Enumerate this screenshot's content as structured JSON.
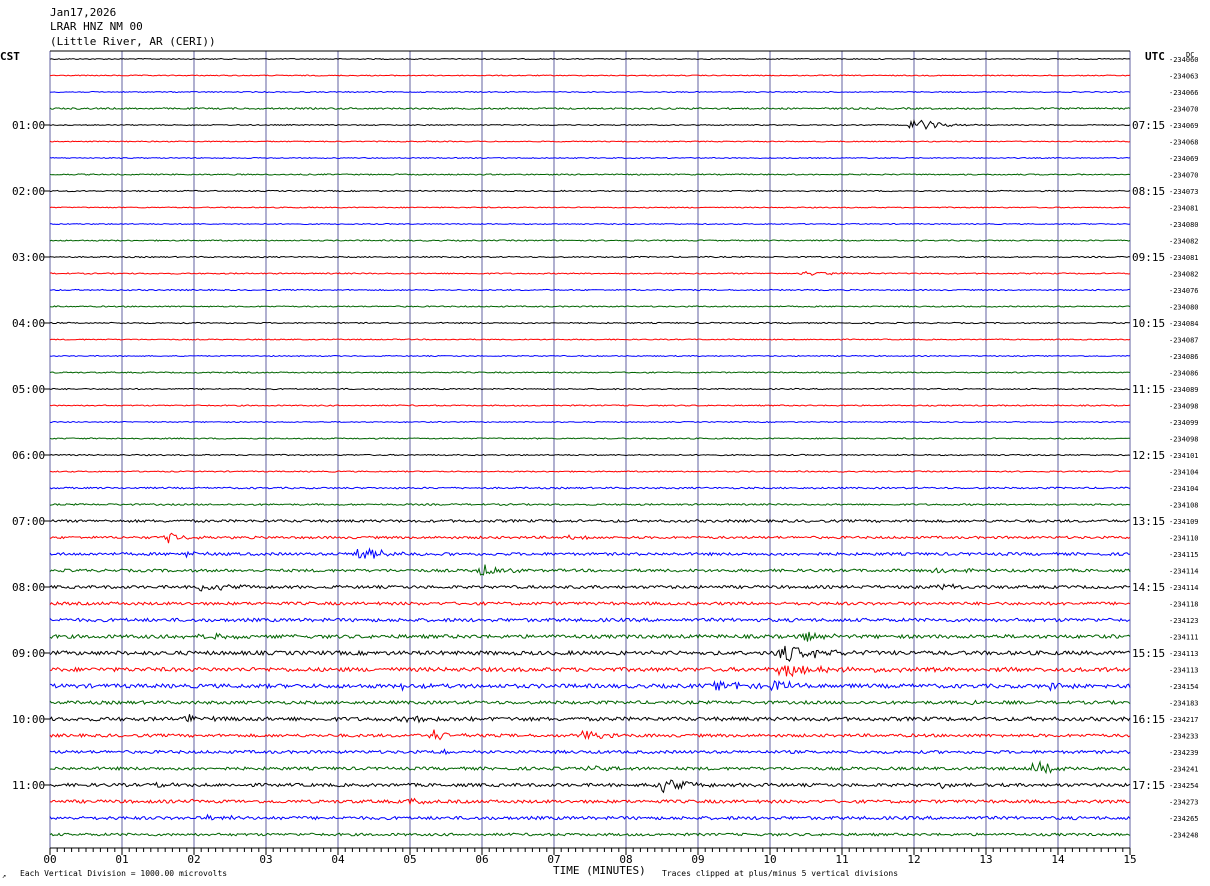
{
  "header": {
    "date": "Jan17,2026",
    "station": "LRAR HNZ NM 00",
    "location": "(Little River, AR (CERI))"
  },
  "left_zone_label": "CST",
  "right_zone_label": "UTC",
  "dc_label": "DC",
  "footer": {
    "scale_note": "Each Vertical Division = 1000.00 microvolts",
    "axis_title": "TIME (MINUTES)",
    "clip_note": "Traces clipped at plus/minus 5 vertical divisions"
  },
  "colors": {
    "black": "#000000",
    "red": "#ff0000",
    "blue": "#0000ff",
    "green": "#006400",
    "grid": "#6060a0"
  },
  "chart_data": {
    "type": "line",
    "x_ticks": [
      "00",
      "01",
      "02",
      "03",
      "04",
      "05",
      "06",
      "07",
      "08",
      "09",
      "10",
      "11",
      "12",
      "13",
      "14",
      "15"
    ],
    "xlim": [
      0,
      15
    ],
    "left_hour_labels": [
      "01:00",
      "02:00",
      "03:00",
      "04:00",
      "05:00",
      "06:00",
      "07:00",
      "08:00",
      "09:00",
      "10:00",
      "11:00"
    ],
    "right_hour_labels": [
      "07:15",
      "08:15",
      "09:15",
      "10:15",
      "11:15",
      "12:15",
      "13:15",
      "14:15",
      "15:15",
      "16:15",
      "17:15"
    ],
    "color_cycle": [
      "black",
      "red",
      "blue",
      "green"
    ],
    "traces": [
      {
        "dc": "-234060",
        "noise": 0.5,
        "events": []
      },
      {
        "dc": "-234063",
        "noise": 0.5,
        "events": []
      },
      {
        "dc": "-234066",
        "noise": 0.5,
        "events": []
      },
      {
        "dc": "-234070",
        "noise": 0.8,
        "events": []
      },
      {
        "dc": "-234069",
        "noise": 0.5,
        "events": [
          {
            "t": 12.0,
            "amp": 9,
            "dur": 0.35
          }
        ]
      },
      {
        "dc": "-234068",
        "noise": 0.5,
        "events": []
      },
      {
        "dc": "-234069",
        "noise": 0.5,
        "events": []
      },
      {
        "dc": "-234070",
        "noise": 0.6,
        "events": []
      },
      {
        "dc": "-234073",
        "noise": 0.6,
        "events": []
      },
      {
        "dc": "-234081",
        "noise": 0.5,
        "events": []
      },
      {
        "dc": "-234080",
        "noise": 0.5,
        "events": []
      },
      {
        "dc": "-234082",
        "noise": 0.6,
        "events": []
      },
      {
        "dc": "-234081",
        "noise": 0.6,
        "events": []
      },
      {
        "dc": "-234082",
        "noise": 0.6,
        "events": [
          {
            "t": 10.5,
            "amp": 2,
            "dur": 0.6
          }
        ]
      },
      {
        "dc": "-234076",
        "noise": 0.6,
        "events": []
      },
      {
        "dc": "-234080",
        "noise": 0.6,
        "events": []
      },
      {
        "dc": "-234084",
        "noise": 0.6,
        "events": []
      },
      {
        "dc": "-234087",
        "noise": 0.5,
        "events": []
      },
      {
        "dc": "-234086",
        "noise": 0.5,
        "events": []
      },
      {
        "dc": "-234086",
        "noise": 0.6,
        "events": []
      },
      {
        "dc": "-234089",
        "noise": 0.6,
        "events": []
      },
      {
        "dc": "-234098",
        "noise": 0.6,
        "events": []
      },
      {
        "dc": "-234099",
        "noise": 0.5,
        "events": []
      },
      {
        "dc": "-234098",
        "noise": 0.6,
        "events": []
      },
      {
        "dc": "-234101",
        "noise": 0.6,
        "events": []
      },
      {
        "dc": "-234104",
        "noise": 0.6,
        "events": []
      },
      {
        "dc": "-234104",
        "noise": 0.8,
        "events": []
      },
      {
        "dc": "-234108",
        "noise": 0.8,
        "events": []
      },
      {
        "dc": "-234109",
        "noise": 1.3,
        "events": []
      },
      {
        "dc": "-234110",
        "noise": 1.2,
        "events": [
          {
            "t": 1.65,
            "amp": 5,
            "dur": 0.3
          },
          {
            "t": 7.2,
            "amp": 2,
            "dur": 0.3
          }
        ]
      },
      {
        "dc": "-234115",
        "noise": 1.4,
        "events": [
          {
            "t": 4.3,
            "amp": 8,
            "dur": 0.4
          },
          {
            "t": 1.9,
            "amp": 3,
            "dur": 0.3
          }
        ]
      },
      {
        "dc": "-234114",
        "noise": 1.4,
        "events": [
          {
            "t": 6.0,
            "amp": 7,
            "dur": 0.35
          },
          {
            "t": 12.3,
            "amp": 3,
            "dur": 0.4
          }
        ]
      },
      {
        "dc": "-234114",
        "noise": 1.5,
        "events": [
          {
            "t": 2.1,
            "amp": 5,
            "dur": 0.5
          },
          {
            "t": 6.9,
            "amp": 3,
            "dur": 0.2
          },
          {
            "t": 12.4,
            "amp": 4,
            "dur": 0.3
          }
        ]
      },
      {
        "dc": "-234118",
        "noise": 1.5,
        "events": []
      },
      {
        "dc": "-234123",
        "noise": 1.7,
        "events": []
      },
      {
        "dc": "-234111",
        "noise": 1.8,
        "events": [
          {
            "t": 1.7,
            "amp": 3,
            "dur": 0.3
          },
          {
            "t": 2.2,
            "amp": 3,
            "dur": 0.4
          },
          {
            "t": 10.5,
            "amp": 5,
            "dur": 0.3
          }
        ]
      },
      {
        "dc": "-234113",
        "noise": 2.0,
        "events": [
          {
            "t": 10.2,
            "amp": 9,
            "dur": 0.6
          },
          {
            "t": 7.8,
            "amp": 2,
            "dur": 0.8
          }
        ]
      },
      {
        "dc": "-234113",
        "noise": 2.0,
        "events": [
          {
            "t": 10.2,
            "amp": 7,
            "dur": 0.6
          },
          {
            "t": 10.8,
            "amp": 3,
            "dur": 1.5
          }
        ]
      },
      {
        "dc": "-234154",
        "noise": 2.0,
        "events": [
          {
            "t": 9.3,
            "amp": 6,
            "dur": 0.4
          },
          {
            "t": 10.05,
            "amp": 7,
            "dur": 0.3
          },
          {
            "t": 13.9,
            "amp": 4,
            "dur": 0.3
          },
          {
            "t": 4.9,
            "amp": 3,
            "dur": 0.3
          }
        ]
      },
      {
        "dc": "-234183",
        "noise": 1.6,
        "events": [
          {
            "t": 12.8,
            "amp": 3,
            "dur": 0.2
          }
        ]
      },
      {
        "dc": "-234217",
        "noise": 1.9,
        "events": [
          {
            "t": 1.9,
            "amp": 4,
            "dur": 0.3
          },
          {
            "t": 5.0,
            "amp": 4,
            "dur": 0.5
          }
        ]
      },
      {
        "dc": "-234233",
        "noise": 1.5,
        "events": [
          {
            "t": 5.3,
            "amp": 7,
            "dur": 0.3
          },
          {
            "t": 7.4,
            "amp": 6,
            "dur": 0.3
          }
        ]
      },
      {
        "dc": "-234239",
        "noise": 1.5,
        "events": [
          {
            "t": 5.4,
            "amp": 3,
            "dur": 0.3
          }
        ]
      },
      {
        "dc": "-234241",
        "noise": 1.5,
        "events": [
          {
            "t": 13.7,
            "amp": 6,
            "dur": 0.45
          },
          {
            "t": 7.5,
            "amp": 2,
            "dur": 0.4
          }
        ]
      },
      {
        "dc": "-234254",
        "noise": 1.6,
        "events": [
          {
            "t": 8.5,
            "amp": 7,
            "dur": 0.5
          },
          {
            "t": 1.5,
            "amp": 3,
            "dur": 0.2
          },
          {
            "t": 12.4,
            "amp": 3,
            "dur": 0.2
          }
        ]
      },
      {
        "dc": "-234273",
        "noise": 1.6,
        "events": [
          {
            "t": 1.8,
            "amp": 3,
            "dur": 0.3
          },
          {
            "t": 5.0,
            "amp": 3,
            "dur": 0.2
          }
        ]
      },
      {
        "dc": "-234265",
        "noise": 1.6,
        "events": [
          {
            "t": 2.2,
            "amp": 3,
            "dur": 0.4
          }
        ]
      },
      {
        "dc": "-234248",
        "noise": 1.3,
        "events": []
      }
    ]
  }
}
